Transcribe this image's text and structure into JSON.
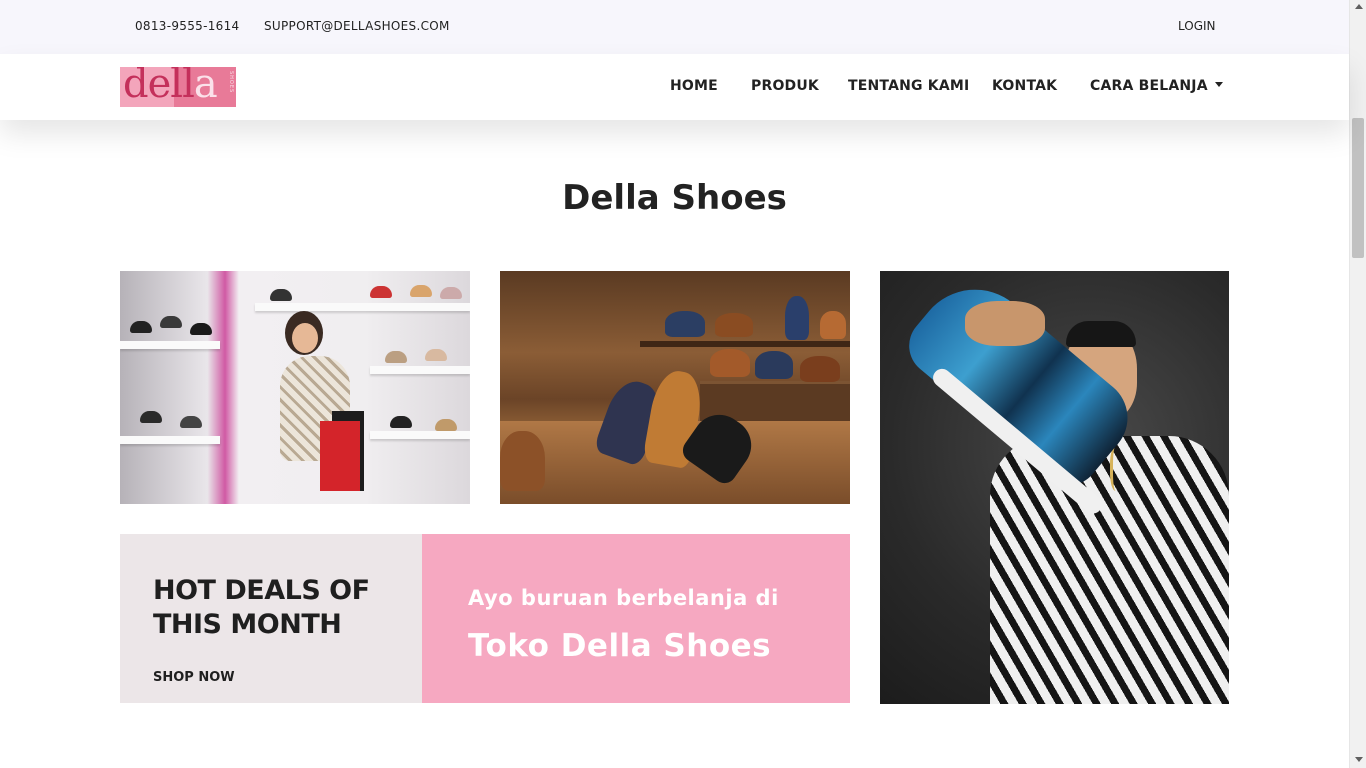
{
  "topbar": {
    "phone": "0813-9555-1614",
    "email": "SUPPORT@DELLASHOES.COM",
    "login": "LOGIN"
  },
  "brand": {
    "logo_text_main": "dell",
    "logo_text_accent": "a",
    "logo_tag": "SHOES",
    "logo_color": "#e87a98"
  },
  "nav": {
    "items": [
      {
        "label": "HOME"
      },
      {
        "label": "PRODUK"
      },
      {
        "label": "TENTANG KAMI"
      },
      {
        "label": "KONTAK"
      },
      {
        "label": "CARA BELANJA",
        "has_dropdown": true
      }
    ]
  },
  "main": {
    "title": "Della Shoes",
    "gallery": [
      {
        "icon": "shoe-store-photo"
      },
      {
        "icon": "leather-shoes-photo"
      },
      {
        "icon": "sneaker-photo"
      }
    ],
    "banner": {
      "headline": "HOT DEALS OF THIS MONTH",
      "cta": "SHOP NOW",
      "tagline": "Ayo buruan berbelanja di",
      "store_name": "Toko Della Shoes",
      "left_color": "#ece6e8",
      "right_color": "#f6a8c1"
    }
  }
}
